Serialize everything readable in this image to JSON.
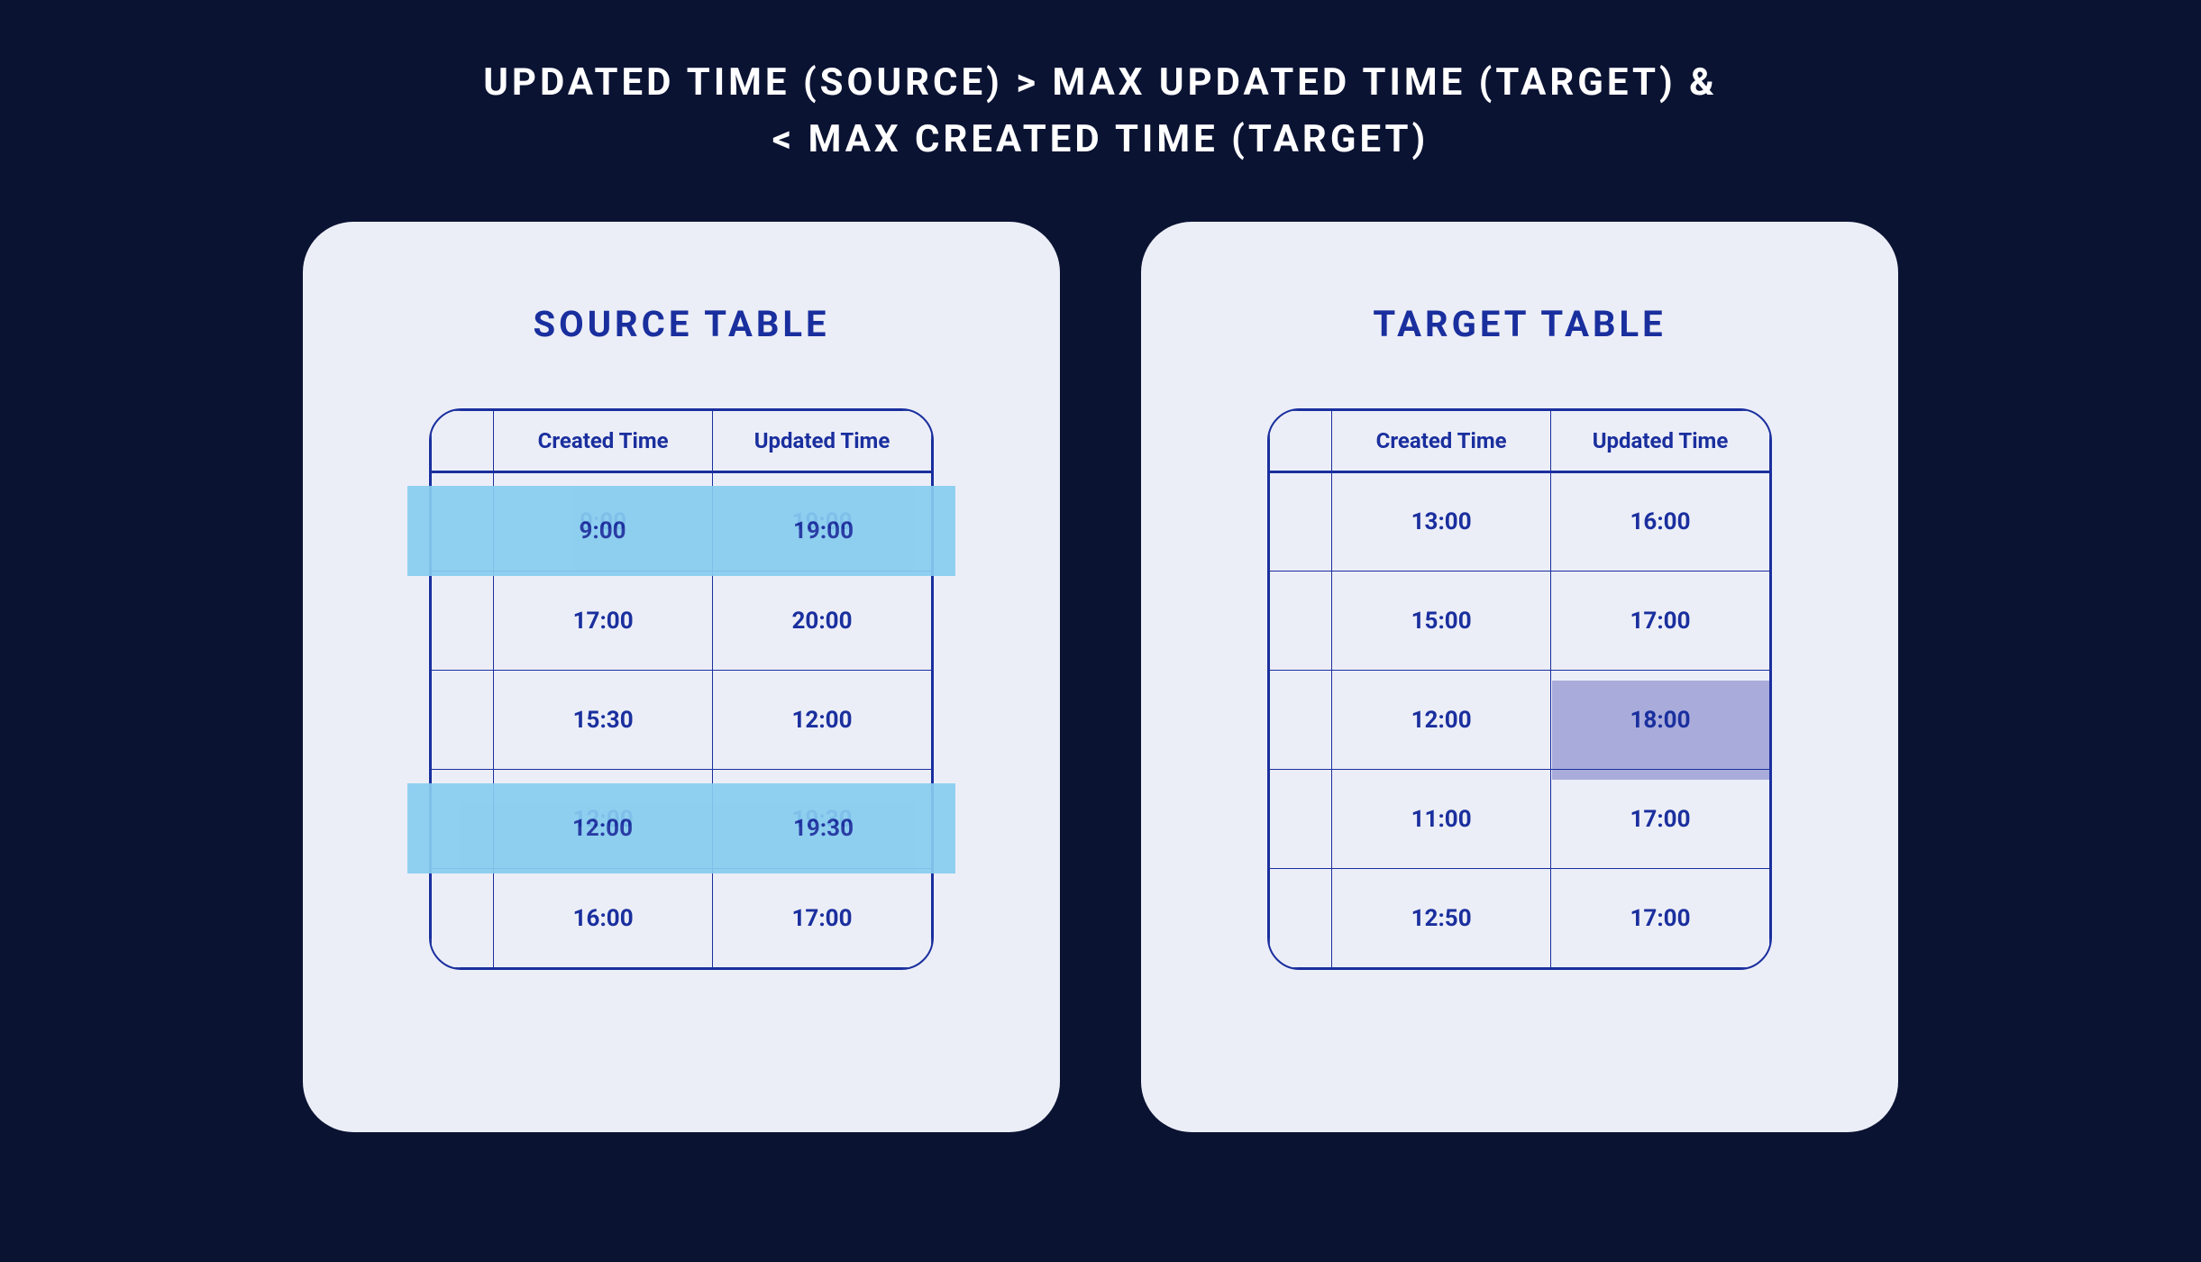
{
  "headline_line1": "UPDATED TIME (SOURCE) > MAX UPDATED TIME (TARGET) &",
  "headline_line2": "< MAX CREATED TIME (TARGET)",
  "source": {
    "title": "SOURCE TABLE",
    "columns": {
      "created": "Created Time",
      "updated": "Updated Time"
    },
    "rows": [
      {
        "created": "9:00",
        "updated": "19:00",
        "highlight_row": true
      },
      {
        "created": "17:00",
        "updated": "20:00"
      },
      {
        "created": "15:30",
        "updated": "12:00"
      },
      {
        "created": "12:00",
        "updated": "19:30",
        "highlight_row": true
      },
      {
        "created": "16:00",
        "updated": "17:00"
      }
    ]
  },
  "target": {
    "title": "TARGET TABLE",
    "columns": {
      "created": "Created Time",
      "updated": "Updated Time"
    },
    "rows": [
      {
        "created": "13:00",
        "updated": "16:00"
      },
      {
        "created": "15:00",
        "updated": "17:00"
      },
      {
        "created": "12:00",
        "updated": "18:00",
        "highlight_cell": "updated"
      },
      {
        "created": "11:00",
        "updated": "17:00"
      },
      {
        "created": "12:50",
        "updated": "17:00"
      }
    ]
  },
  "colors": {
    "background": "#0b1333",
    "card": "#eceef7",
    "ink": "#1a2f9e",
    "row_highlight": "#87cdf0",
    "cell_highlight": "#a9acdb"
  }
}
